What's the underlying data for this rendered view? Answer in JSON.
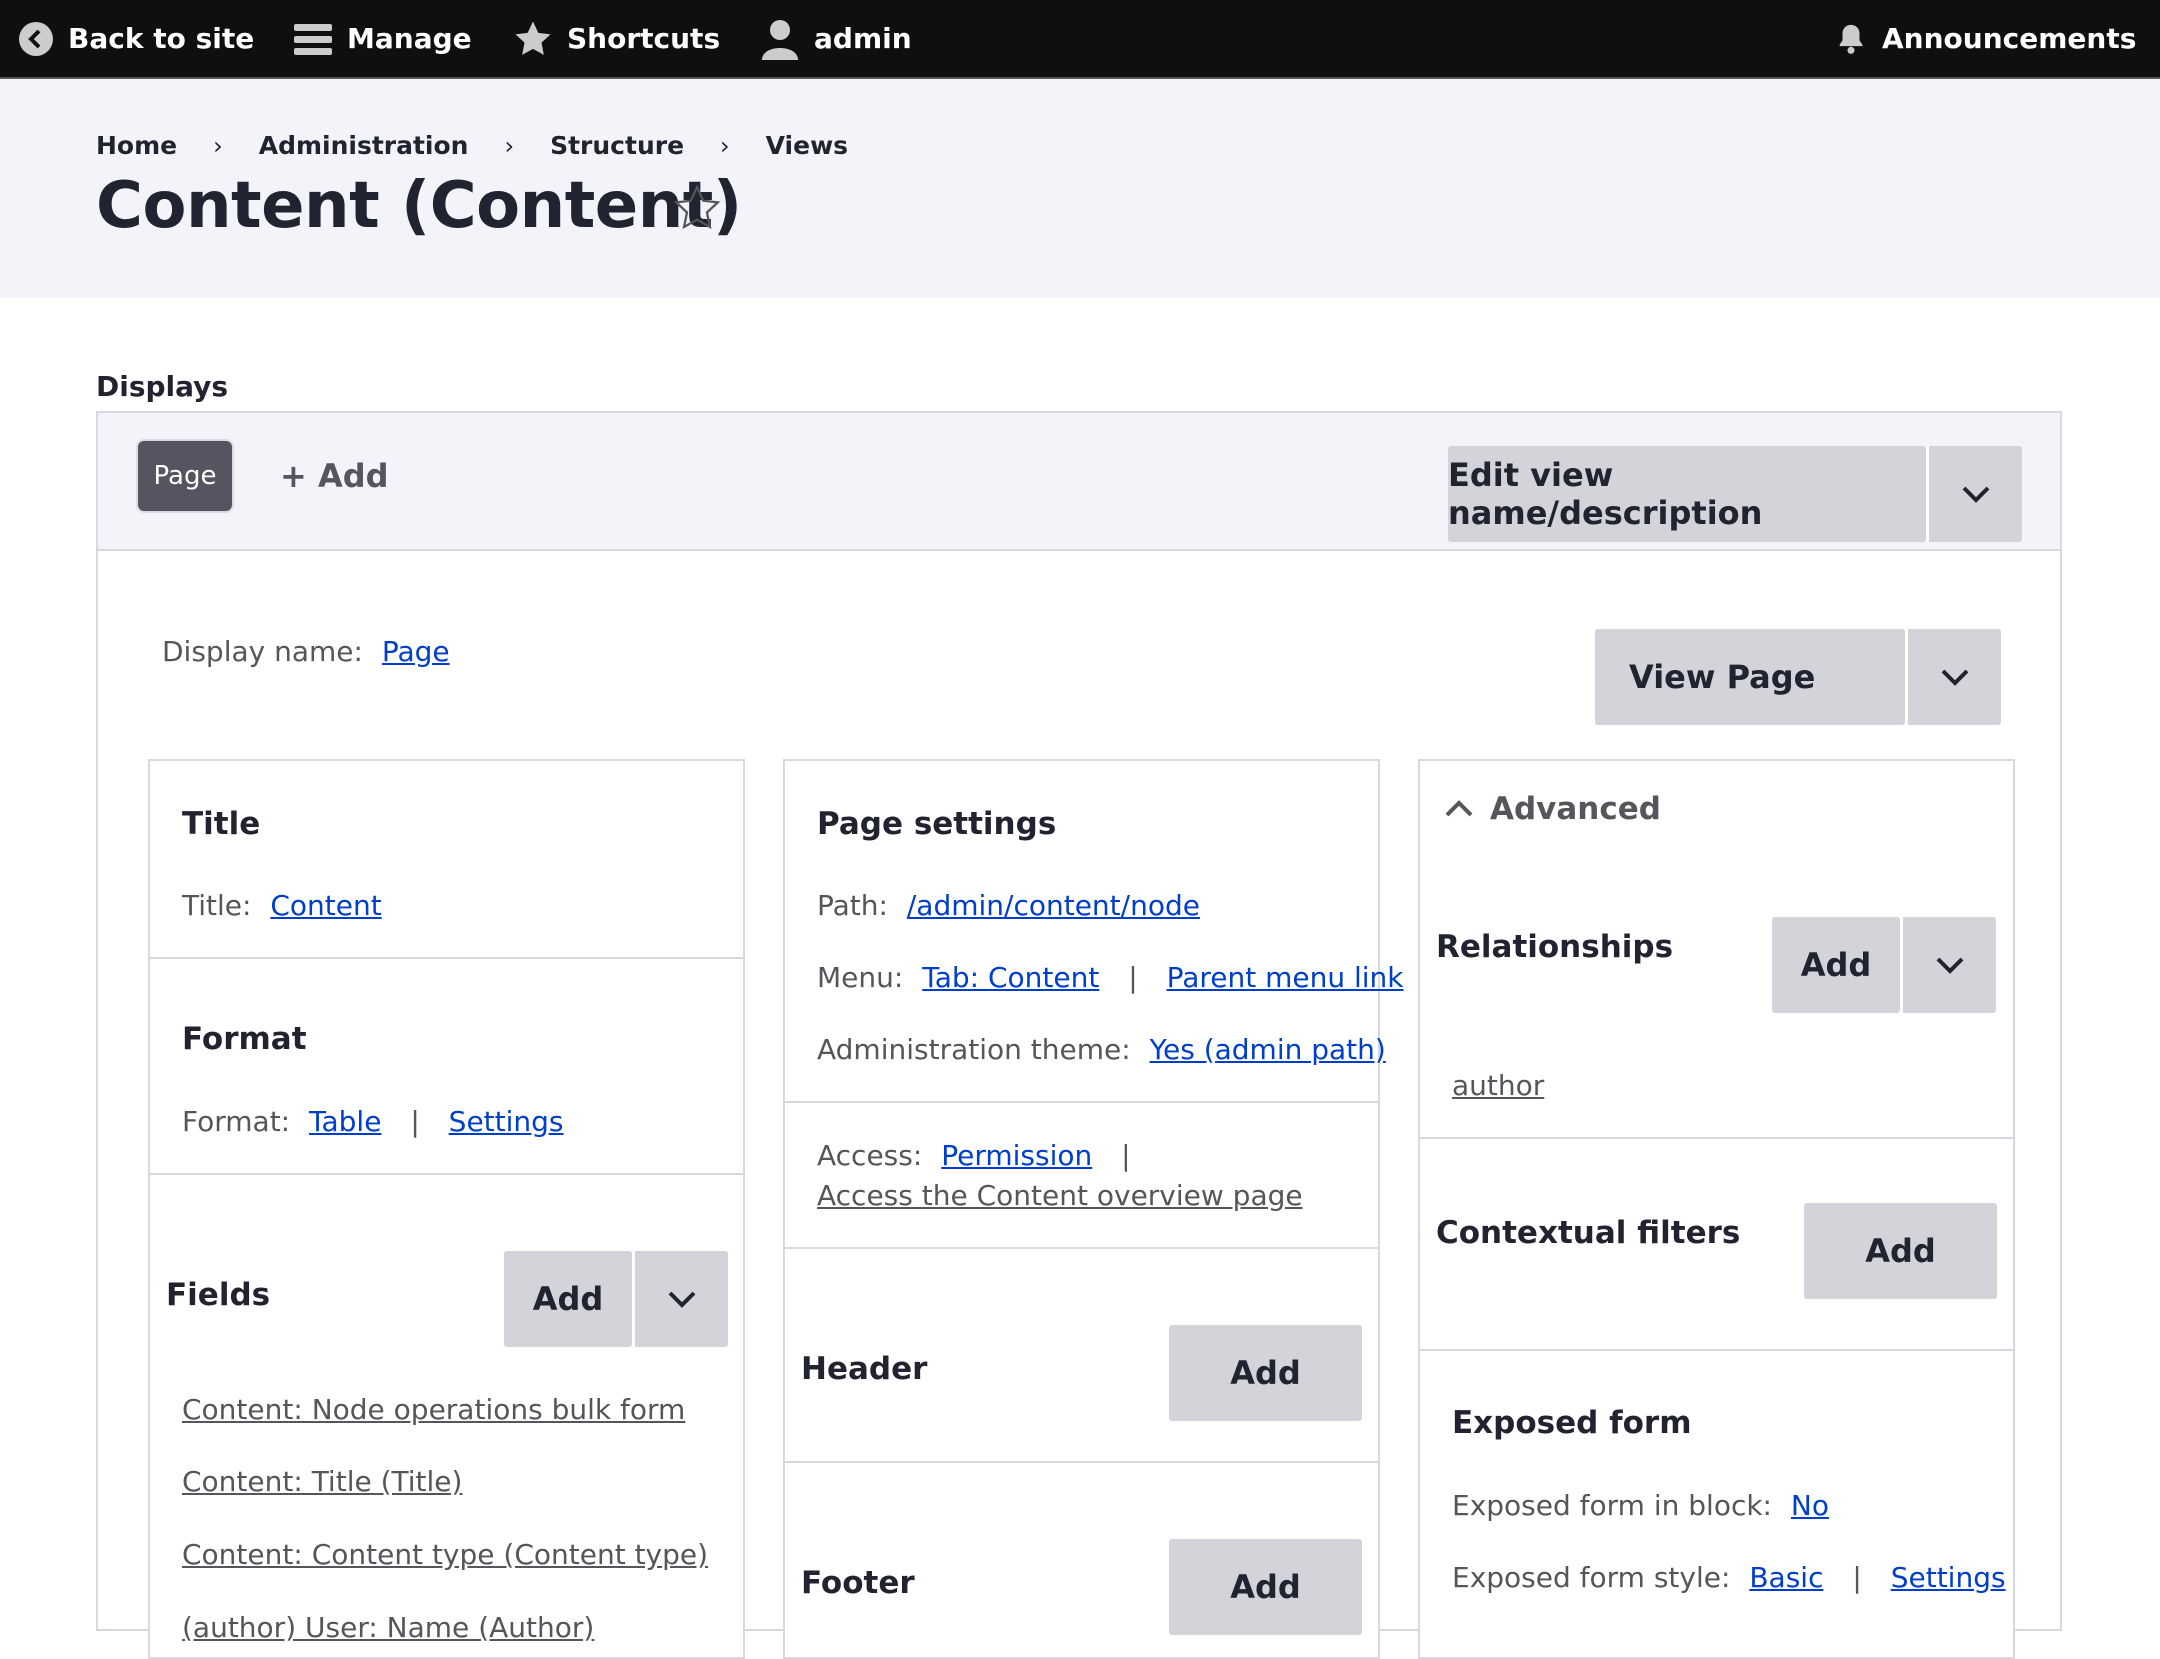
{
  "toolbar": {
    "back": "Back to site",
    "manage": "Manage",
    "shortcuts": "Shortcuts",
    "user": "admin",
    "announcements": "Announcements"
  },
  "breadcrumb": [
    "Home",
    "Administration",
    "Structure",
    "Views"
  ],
  "page_title": "Content (Content)",
  "displays": {
    "label": "Displays",
    "tab_page": "Page",
    "tab_add": "+ Add",
    "edit_view": "Edit view name/description",
    "display_name_label": "Display name:",
    "display_name_value": "Page",
    "view_page": "View Page"
  },
  "col1": {
    "title_heading": "Title",
    "title_label": "Title:",
    "title_value": "Content",
    "format_heading": "Format",
    "format_label": "Format:",
    "format_value": "Table",
    "format_settings": "Settings",
    "fields_heading": "Fields",
    "fields_add": "Add",
    "fields": [
      "Content: Node operations bulk form",
      "Content: Title (Title)",
      "Content: Content type (Content type)",
      "(author) User: Name (Author)"
    ]
  },
  "col2": {
    "page_settings_heading": "Page settings",
    "path_label": "Path:",
    "path_value": "/admin/content/node",
    "menu_label": "Menu:",
    "menu_value": "Tab: Content",
    "menu_parent": "Parent menu link",
    "admin_theme_label": "Administration theme:",
    "admin_theme_value": "Yes (admin path)",
    "access_label": "Access:",
    "access_value": "Permission",
    "access_permission": "Access the Content overview page",
    "header_heading": "Header",
    "header_add": "Add",
    "footer_heading": "Footer",
    "footer_add": "Add"
  },
  "col3": {
    "advanced": "Advanced",
    "relationships_heading": "Relationships",
    "relationships_add": "Add",
    "relationship_item": "author",
    "contextual_heading": "Contextual filters",
    "contextual_add": "Add",
    "exposed_heading": "Exposed form",
    "exposed_block_label": "Exposed form in block:",
    "exposed_block_value": "No",
    "exposed_style_label": "Exposed form style:",
    "exposed_style_value": "Basic",
    "exposed_style_settings": "Settings"
  }
}
